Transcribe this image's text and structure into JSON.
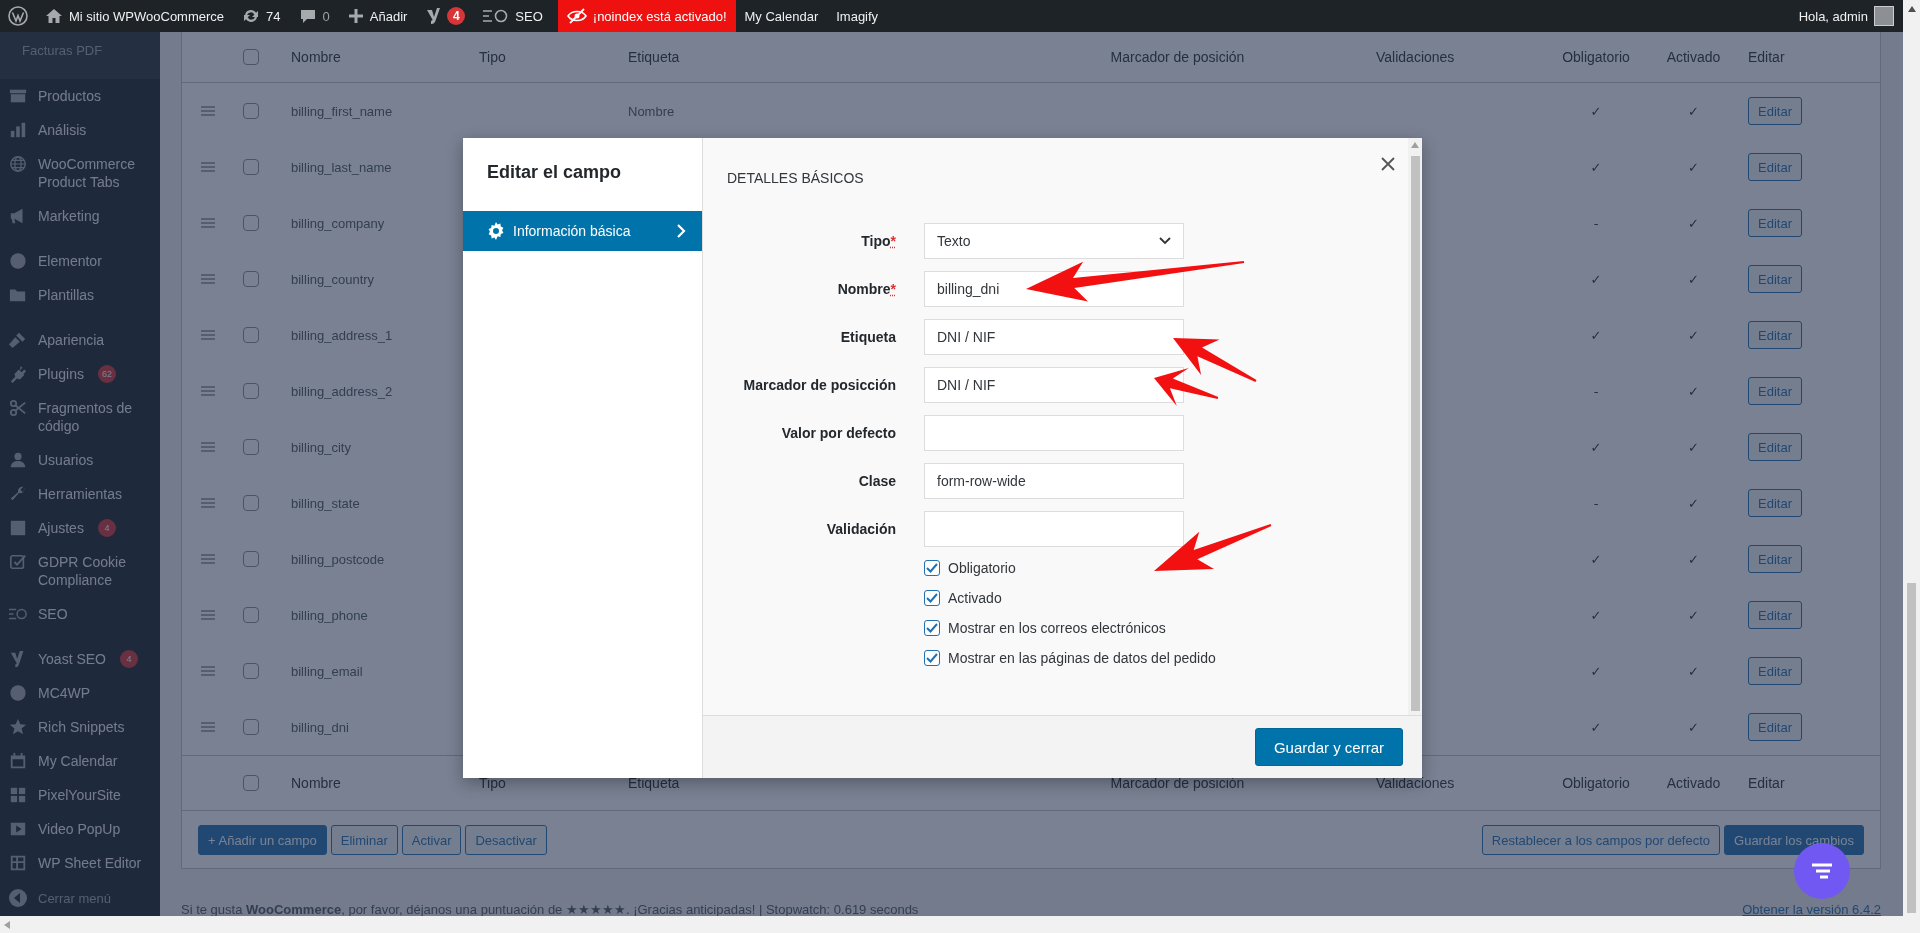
{
  "admin_bar": {
    "site_name": "Mi sitio WPWooCommerce",
    "updates": "74",
    "comments": "0",
    "new_label": "Añadir",
    "yoast_badge": "4",
    "seo_label": "SEO",
    "noindex_label": "¡noindex está activado!",
    "links": [
      "My Calendar",
      "Imagify"
    ],
    "greeting": "Hola, admin"
  },
  "sidebar": {
    "header": "Facturas PDF",
    "groups": [
      [
        {
          "label": "Productos"
        },
        {
          "label": "Análisis"
        },
        {
          "label": "WooCommerce Product Tabs"
        },
        {
          "label": "Marketing"
        }
      ],
      [
        {
          "label": "Elementor"
        },
        {
          "label": "Plantillas"
        }
      ],
      [
        {
          "label": "Apariencia"
        },
        {
          "label": "Plugins",
          "badge": "62"
        },
        {
          "label": "Fragmentos de código"
        },
        {
          "label": "Usuarios"
        },
        {
          "label": "Herramientas"
        },
        {
          "label": "Ajustes",
          "badge": "4"
        },
        {
          "label": "GDPR Cookie Compliance"
        },
        {
          "label": "SEO"
        }
      ],
      [
        {
          "label": "Yoast SEO",
          "badge": "4"
        },
        {
          "label": "MC4WP"
        },
        {
          "label": "Rich Snippets"
        },
        {
          "label": "My Calendar"
        },
        {
          "label": "PixelYourSite"
        },
        {
          "label": "Video PopUp"
        },
        {
          "label": "WP Sheet Editor"
        }
      ]
    ],
    "collapse_label": "Cerrar menú"
  },
  "table": {
    "columns": [
      "Nombre",
      "Tipo",
      "Etiqueta",
      "Marcador de posición",
      "Validaciones",
      "Obligatorio",
      "Activado",
      "Editar"
    ],
    "header_checked": false,
    "rows": [
      {
        "name": "billing_first_name",
        "label": "Nombre",
        "required": "✓",
        "enabled": "✓",
        "edit": "Editar",
        "selected": false
      },
      {
        "name": "billing_last_name",
        "required": "✓",
        "enabled": "✓",
        "edit": "Editar",
        "selected": false
      },
      {
        "name": "billing_company",
        "required": "-",
        "enabled": "✓",
        "edit": "Editar",
        "selected": false
      },
      {
        "name": "billing_country",
        "required": "✓",
        "enabled": "✓",
        "edit": "Editar",
        "selected": false
      },
      {
        "name": "billing_address_1",
        "required": "✓",
        "enabled": "✓",
        "edit": "Editar",
        "selected": false
      },
      {
        "name": "billing_address_2",
        "required": "-",
        "enabled": "✓",
        "edit": "Editar",
        "selected": false
      },
      {
        "name": "billing_city",
        "required": "✓",
        "enabled": "✓",
        "edit": "Editar",
        "selected": false
      },
      {
        "name": "billing_state",
        "required": "-",
        "enabled": "✓",
        "edit": "Editar",
        "selected": false
      },
      {
        "name": "billing_postcode",
        "required": "✓",
        "enabled": "✓",
        "edit": "Editar",
        "selected": false
      },
      {
        "name": "billing_phone",
        "required": "✓",
        "enabled": "✓",
        "edit": "Editar",
        "selected": false
      },
      {
        "name": "billing_email",
        "required": "✓",
        "enabled": "✓",
        "edit": "Editar",
        "selected": false
      },
      {
        "name": "billing_dni",
        "required": "✓",
        "enabled": "✓",
        "edit": "Editar",
        "selected": false
      }
    ],
    "footer_columns": [
      "Nombre",
      "Tipo",
      "Etiqueta",
      "Marcador de posición",
      "Validaciones",
      "Obligatorio",
      "Activado",
      "Editar"
    ],
    "footer_checked": false
  },
  "actions": {
    "left": [
      {
        "label": "+ Añadir un campo",
        "primary": true
      },
      {
        "label": "Eliminar",
        "primary": false
      },
      {
        "label": "Activar",
        "primary": false
      },
      {
        "label": "Desactivar",
        "primary": false
      }
    ],
    "right": [
      {
        "label": "Restablecer a los campos por defecto",
        "primary": false
      },
      {
        "label": "Guardar los cambios",
        "primary": true
      }
    ]
  },
  "footer": {
    "text": "Si te gusta **WooCommerce**, por favor, déjanos una puntuación de ★★★★★. ¡Gracias anticipadas! | Stopwatch: 0.619 seconds",
    "version_link": "Obtener la versión 6.4.2"
  },
  "modal": {
    "title": "Editar el campo",
    "tabs": [
      {
        "label": "Información básica",
        "selected": true
      }
    ],
    "section_title": "DETALLES BÁSICOS",
    "fields": [
      {
        "kind": "select",
        "label": "Tipo",
        "required_mark": "*",
        "value": "Texto"
      },
      {
        "kind": "text",
        "label": "Nombre",
        "required_mark": "*",
        "value": "billing_dni"
      },
      {
        "kind": "text",
        "label": "Etiqueta",
        "value": "DNI / NIF"
      },
      {
        "kind": "text",
        "label": "Marcador de posicción",
        "value": "DNI / NIF"
      },
      {
        "kind": "text",
        "label": "Valor por defecto"
      },
      {
        "kind": "text",
        "label": "Clase",
        "value": "form-row-wide"
      },
      {
        "kind": "text",
        "label": "Validación"
      }
    ],
    "checkboxes": [
      {
        "label": "Obligatorio",
        "checked": true
      },
      {
        "label": "Activado",
        "checked": true
      },
      {
        "label": "Mostrar en los correos electrónicos",
        "checked": true
      },
      {
        "label": "Mostrar en las páginas de datos del pedido",
        "checked": true
      }
    ],
    "save_button": "Guardar y cerrar"
  }
}
